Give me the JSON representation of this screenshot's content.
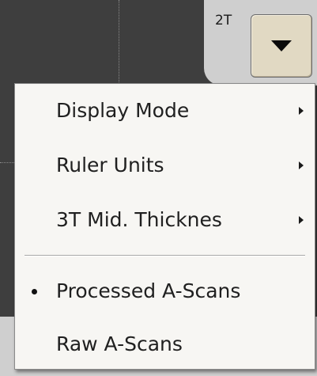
{
  "window": {
    "tab_label": "2T"
  },
  "dropdown_button": {
    "icon": "triangle-down-icon"
  },
  "menu": {
    "items": [
      {
        "label": "Display Mode",
        "has_submenu": true
      },
      {
        "label": "Ruler Units",
        "has_submenu": true
      },
      {
        "label": "3T Mid. Thicknes",
        "has_submenu": true
      },
      {
        "label": "Processed A-Scans",
        "checked": true
      },
      {
        "label": "Raw A-Scans",
        "checked": false
      }
    ]
  },
  "colors": {
    "background_dark": "#3e3e3e",
    "panel_gray": "#cfcfcf",
    "button_face": "#e1d9c3",
    "menu_bg": "#f7f6f3"
  }
}
